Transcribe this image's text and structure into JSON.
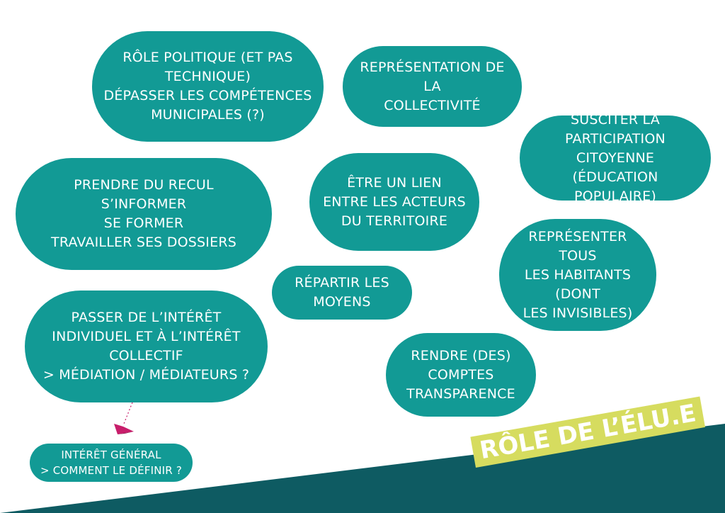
{
  "title": "RÔLE DE L’ÉLU.E",
  "colors": {
    "bubble": "#129a95",
    "band": "#0e5b62",
    "title_box": "#d6dc5f",
    "arrow": "#c81e6b"
  },
  "bubbles": [
    {
      "text": "RÔLE POLITIQUE (ET PAS\nTECHNIQUE)\nDÉPASSER LES COMPÉTENCES\nMUNICIPALES (?)"
    },
    {
      "text": "REPRÉSENTATION DE LA\nCOLLECTIVITÉ"
    },
    {
      "text": "SUSCITER LA\nPARTICIPATION CITOYENNE\n(ÉDUCATION POPULAIRE)"
    },
    {
      "text": "PRENDRE DU RECUL\nS’INFORMER\nSE FORMER\nTRAVAILLER SES DOSSIERS"
    },
    {
      "text": "ÊTRE UN LIEN\nENTRE LES ACTEURS\nDU TERRITOIRE"
    },
    {
      "text": "REPRÉSENTER TOUS\nLES HABITANTS (DONT\nLES INVISIBLES)"
    },
    {
      "text": "RÉPARTIR LES\nMOYENS"
    },
    {
      "text": "PASSER DE L’INTÉRÊT\nINDIVIDUEL ET À L’INTÉRÊT\nCOLLECTIF\n> MÉDIATION / MÉDIATEURS ?"
    },
    {
      "text": "RENDRE (DES)\nCOMPTES\nTRANSPARENCE"
    },
    {
      "text": "INTÉRÊT GÉNÉRAL\n> COMMENT LE DÉFINIR ?"
    }
  ]
}
